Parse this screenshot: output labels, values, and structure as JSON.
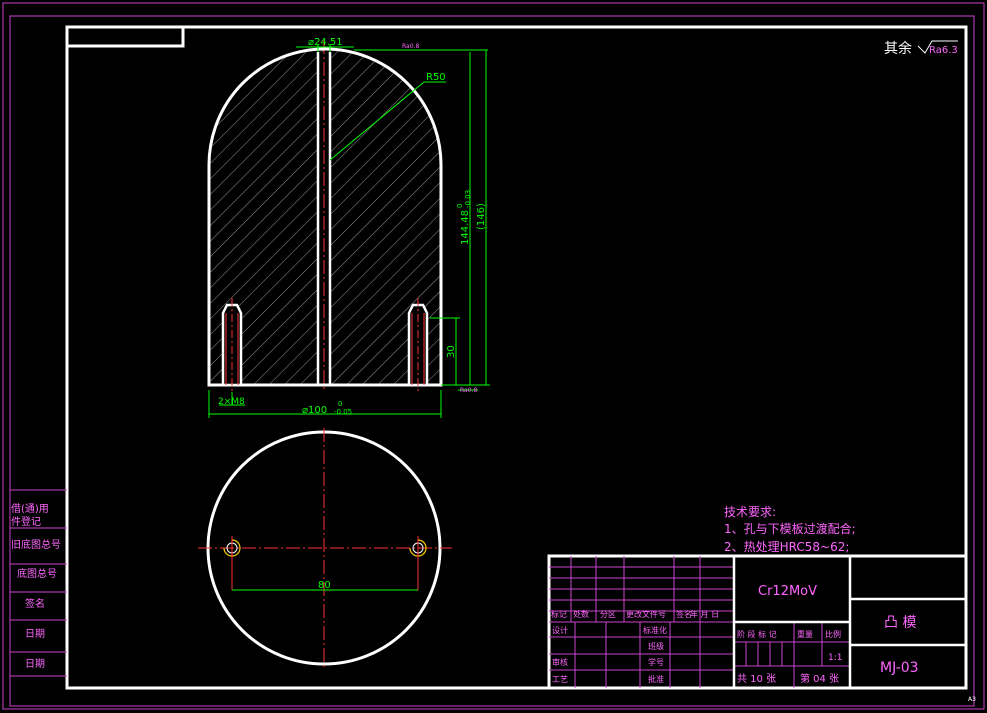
{
  "surface_finish": {
    "prefix": "其余",
    "value": "Ra6.3"
  },
  "corner_mark": "A3",
  "dimensions": {
    "top_diameter": "⌀24.51",
    "small_finish": "Ra0.8",
    "radius": "R50",
    "height_value": "144.48",
    "height_tol_upper": "0",
    "height_tol_lower": "-0.03",
    "height_ref": "(146)",
    "hole_depth": "30",
    "thread": "2×M8",
    "base_diameter": "⌀100",
    "base_tol_upper": "0",
    "base_tol_lower": "-0.05",
    "right_finish": "Ra0.8",
    "hole_spacing": "80"
  },
  "tech_requirements": {
    "title": "技术要求:",
    "items": [
      "1、孔与下模板过渡配合;",
      "2、热处理HRC58~62;"
    ]
  },
  "side_labels": [
    "借(通)用",
    "件登记",
    "旧底图总号",
    "底图总号",
    "签名",
    "日期",
    "日期"
  ],
  "title_block": {
    "material": "Cr12MoV",
    "part_name": "凸 模",
    "drawing_no": "MJ-03",
    "header_row": [
      "标记",
      "处数",
      "分区",
      "更改文件号",
      "签名",
      "年 月 日"
    ],
    "left_labels": [
      "设计",
      "",
      "审核",
      "工艺"
    ],
    "mid_labels": [
      "标准化",
      "班级",
      "学号",
      "批准"
    ],
    "stage_header": [
      "阶 段 标 记",
      "重量",
      "比例"
    ],
    "scale": "1:1",
    "sheets_total": "共 10 张",
    "sheet_no": "第 04 张"
  },
  "colors": {
    "outline": "#ffffff",
    "dimension": "#00ff00",
    "center": "#ff3333",
    "hatch": "#cccccc",
    "title_grid": "#cc44cc",
    "magenta_text": "#ff66ff",
    "center_marks": "#ffcc00"
  }
}
